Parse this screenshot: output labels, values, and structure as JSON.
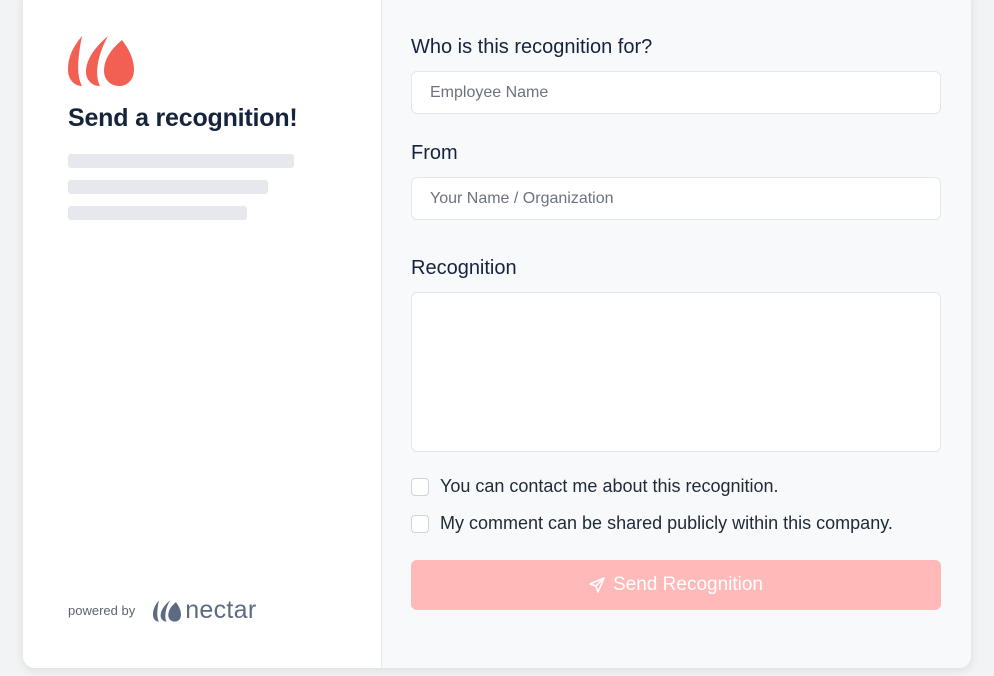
{
  "left_panel": {
    "title": "Send a recognition!",
    "powered_by": "powered by",
    "brand": "nectar",
    "logo_icon": "nectar-petals-icon",
    "logo_color": "#f25f53"
  },
  "form": {
    "recipient": {
      "label": "Who is this recognition for?",
      "placeholder": "Employee Name",
      "value": ""
    },
    "from": {
      "label": "From",
      "placeholder": "Your Name / Organization",
      "value": ""
    },
    "recognition": {
      "label": "Recognition",
      "value": ""
    },
    "checkboxes": [
      {
        "label": "You can contact me about this recognition.",
        "checked": false
      },
      {
        "label": "My comment can be shared publicly within this company.",
        "checked": false
      }
    ],
    "submit": {
      "label": "Send Recognition",
      "icon": "paper-plane-icon",
      "color": "#ffb9b9"
    }
  }
}
